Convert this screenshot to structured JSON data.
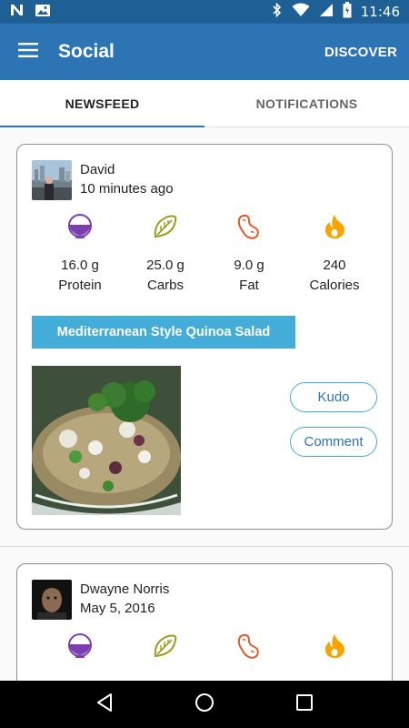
{
  "status_bar": {
    "time": "11:46",
    "left_icons": [
      "n-app-icon",
      "image-icon"
    ],
    "right_icons": [
      "bluetooth-icon",
      "wifi-icon",
      "signal-icon",
      "battery-icon"
    ]
  },
  "app_bar": {
    "title": "Social",
    "action_label": "DISCOVER",
    "color": "#2c74b3"
  },
  "tabs": [
    {
      "label": "NEWSFEED",
      "active": true
    },
    {
      "label": "NOTIFICATIONS",
      "active": false
    }
  ],
  "posts": [
    {
      "user_name": "David",
      "time": "10 minutes ago",
      "macros": [
        {
          "value": "16.0 g",
          "label": "Protein",
          "icon": "protein-bowl-icon"
        },
        {
          "value": "25.0 g",
          "label": "Carbs",
          "icon": "carbs-leaf-icon"
        },
        {
          "value": "9.0 g",
          "label": "Fat",
          "icon": "fat-peanut-icon"
        },
        {
          "value": "240",
          "label": "Calories",
          "icon": "calories-flame-icon"
        }
      ],
      "recipe_title": "Mediterranean Style Quinoa Salad",
      "kudo_label": "Kudo",
      "comment_label": "Comment"
    },
    {
      "user_name": "Dwayne Norris",
      "time": "May 5, 2016"
    }
  ],
  "colors": {
    "accent": "#43acd8",
    "protein": "#7b3fb0",
    "carbs": "#9a9a1c",
    "fat": "#e05a2a",
    "calories": "#f5a400"
  },
  "nav_bar": {
    "icons": [
      "back-icon",
      "home-icon",
      "recents-icon"
    ]
  }
}
